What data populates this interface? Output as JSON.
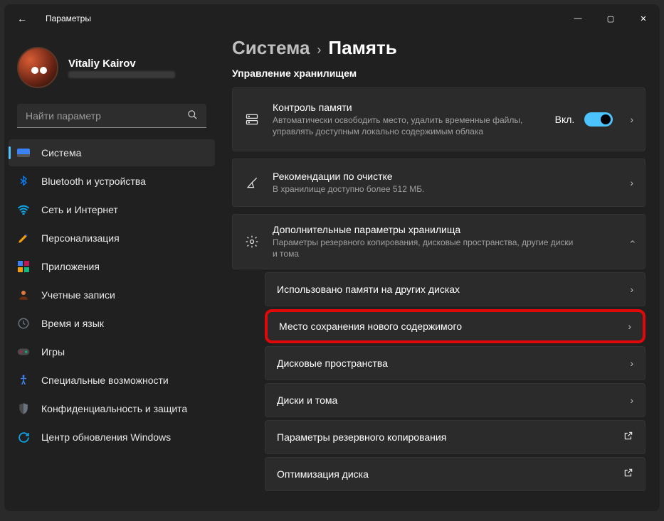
{
  "window": {
    "title": "Параметры"
  },
  "user": {
    "name": "Vitaliy Kairov"
  },
  "search": {
    "placeholder": "Найти параметр"
  },
  "nav": {
    "items": [
      {
        "label": "Система",
        "active": true
      },
      {
        "label": "Bluetooth и устройства"
      },
      {
        "label": "Сеть и Интернет"
      },
      {
        "label": "Персонализация"
      },
      {
        "label": "Приложения"
      },
      {
        "label": "Учетные записи"
      },
      {
        "label": "Время и язык"
      },
      {
        "label": "Игры"
      },
      {
        "label": "Специальные возможности"
      },
      {
        "label": "Конфиденциальность и защита"
      },
      {
        "label": "Центр обновления Windows"
      }
    ]
  },
  "breadcrumb": {
    "parent": "Система",
    "sep": "›",
    "current": "Память"
  },
  "section": {
    "storage_management": "Управление хранилищем"
  },
  "cards": {
    "storage_sense": {
      "title": "Контроль памяти",
      "sub": "Автоматически освободить место, удалить временные файлы, управлять доступным локально содержимым облака",
      "toggle_state": "Вкл."
    },
    "cleanup": {
      "title": "Рекомендации по очистке",
      "sub": "В хранилище доступно более 512 МБ."
    },
    "advanced": {
      "title": "Дополнительные параметры хранилища",
      "sub": "Параметры резервного копирования, дисковые пространства, другие диски и тома"
    },
    "sub_items": {
      "other_drives": "Использовано памяти на других дисках",
      "save_locations": "Место сохранения нового содержимого",
      "storage_spaces": "Дисковые пространства",
      "disks_volumes": "Диски и тома",
      "backup_options": "Параметры резервного копирования",
      "drive_optimization": "Оптимизация диска"
    }
  }
}
